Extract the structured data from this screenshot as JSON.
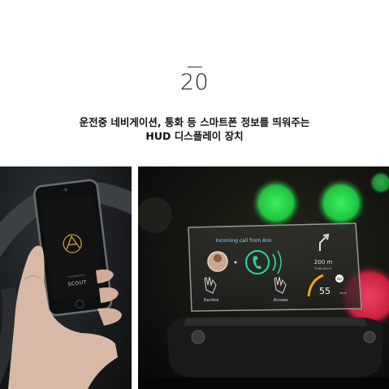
{
  "header": {
    "number": "20",
    "caption_line1": "운전중 네비게이션, 통화 등 스마트폰 정보를 띄워주는",
    "caption_line2": "HUD 디스플레이 장치"
  },
  "left_photo": {
    "phone_small_text": "Connected to",
    "phone_brand": "SCOUT"
  },
  "right_photo": {
    "call_text": "Incoming call from Ann",
    "decline_label": "Decline",
    "answer_label": "Answer",
    "distance_value": "200 m",
    "distance_caption": "TURN RIGHT",
    "speed_value": "55",
    "speed_unit": "km/h",
    "speed_limit": "60"
  },
  "colors": {
    "accent_green": "#27d84a",
    "accent_red": "#e8304a",
    "speed_orange": "#f0a020"
  }
}
